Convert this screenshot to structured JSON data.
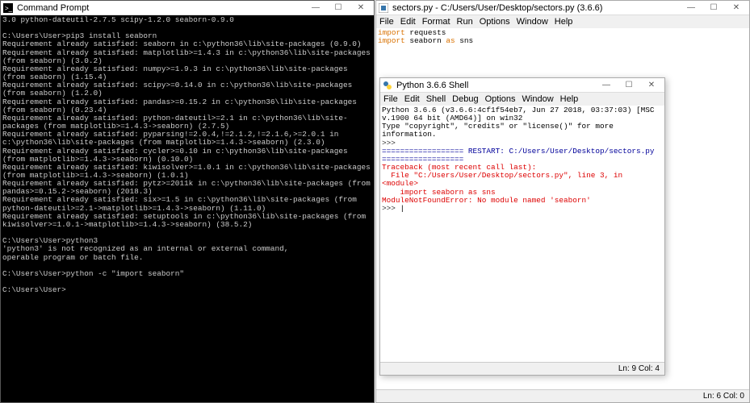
{
  "cmd": {
    "title": "Command Prompt",
    "body": "3.0 python-dateutil-2.7.5 scipy-1.2.0 seaborn-0.9.0\n\nC:\\Users\\User>pip3 install seaborn\nRequirement already satisfied: seaborn in c:\\python36\\lib\\site-packages (0.9.0)\nRequirement already satisfied: matplotlib>=1.4.3 in c:\\python36\\lib\\site-packages (from seaborn) (3.0.2)\nRequirement already satisfied: numpy>=1.9.3 in c:\\python36\\lib\\site-packages (from seaborn) (1.15.4)\nRequirement already satisfied: scipy>=0.14.0 in c:\\python36\\lib\\site-packages (from seaborn) (1.2.0)\nRequirement already satisfied: pandas>=0.15.2 in c:\\python36\\lib\\site-packages (from seaborn) (0.23.4)\nRequirement already satisfied: python-dateutil>=2.1 in c:\\python36\\lib\\site-packages (from matplotlib>=1.4.3->seaborn) (2.7.5)\nRequirement already satisfied: pyparsing!=2.0.4,!=2.1.2,!=2.1.6,>=2.0.1 in c:\\python36\\lib\\site-packages (from matplotlib>=1.4.3->seaborn) (2.3.0)\nRequirement already satisfied: cycler>=0.10 in c:\\python36\\lib\\site-packages (from matplotlib>=1.4.3->seaborn) (0.10.0)\nRequirement already satisfied: kiwisolver>=1.0.1 in c:\\python36\\lib\\site-packages (from matplotlib>=1.4.3->seaborn) (1.0.1)\nRequirement already satisfied: pytz>=2011k in c:\\python36\\lib\\site-packages (from pandas>=0.15.2->seaborn) (2018.3)\nRequirement already satisfied: six>=1.5 in c:\\python36\\lib\\site-packages (from python-dateutil>=2.1->matplotlib>=1.4.3->seaborn) (1.11.0)\nRequirement already satisfied: setuptools in c:\\python36\\lib\\site-packages (from kiwisolver>=1.0.1->matplotlib>=1.4.3->seaborn) (38.5.2)\n\nC:\\Users\\User>python3\n'python3' is not recognized as an internal or external command,\noperable program or batch file.\n\nC:\\Users\\User>python -c \"import seaborn\"\n\nC:\\Users\\User>"
  },
  "editor": {
    "title": "sectors.py - C:/Users/User/Desktop/sectors.py (3.6.6)",
    "menu": [
      "File",
      "Edit",
      "Format",
      "Run",
      "Options",
      "Window",
      "Help"
    ],
    "code_lines": [
      {
        "kw": "import",
        "rest": " requests"
      },
      {
        "kw": "import",
        "rest": " seaborn ",
        "kw2": "as",
        "rest2": " sns"
      }
    ],
    "status": "Ln: 6 Col: 0"
  },
  "shell": {
    "title": "Python 3.6.6 Shell",
    "menu": [
      "File",
      "Edit",
      "Shell",
      "Debug",
      "Options",
      "Window",
      "Help"
    ],
    "header": "Python 3.6.6 (v3.6.6:4cf1f54eb7, Jun 27 2018, 03:37:03) [MSC v.1900 64 bit (AMD64)] on win32\nType \"copyright\", \"credits\" or \"license()\" for more information.",
    "restart": "================== RESTART: C:/Users/User/Desktop/sectors.py ==================",
    "tb1": "Traceback (most recent call last):",
    "tb2": "  File \"C:/Users/User/Desktop/sectors.py\", line 3, in <module>",
    "tb3": "    import seaborn as sns",
    "tb4": "ModuleNotFoundError: No module named 'seaborn'",
    "prompt": ">>> ",
    "status": "Ln: 9 Col: 4"
  },
  "controls": {
    "min": "—",
    "max": "☐",
    "close": "✕"
  }
}
